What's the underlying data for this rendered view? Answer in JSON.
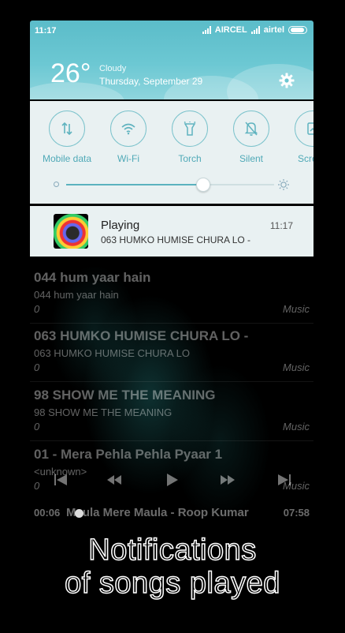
{
  "status_bar": {
    "time": "11:17",
    "carrier1": "AIRCEL",
    "carrier2": "airtel"
  },
  "weather": {
    "temperature": "26°",
    "condition": "Cloudy",
    "date": "Thursday, September 29"
  },
  "quick_settings": {
    "toggles": [
      {
        "label": "Mobile data",
        "icon": "mobile-data-icon"
      },
      {
        "label": "Wi-Fi",
        "icon": "wifi-icon"
      },
      {
        "label": "Torch",
        "icon": "torch-icon"
      },
      {
        "label": "Silent",
        "icon": "silent-bell-icon"
      },
      {
        "label": "Screen",
        "icon": "screenshot-icon"
      }
    ],
    "brightness_level": 0.66
  },
  "notification": {
    "title": "Playing",
    "subtitle": "063 HUMKO HUMISE CHURA LO -",
    "time": "11:17"
  },
  "songs": [
    {
      "title": "044 hum yaar hain",
      "artist": "044 hum yaar hain",
      "number": "0",
      "genre": "Music"
    },
    {
      "title": "063 HUMKO HUMISE CHURA LO -",
      "artist": "063 HUMKO HUMISE CHURA LO",
      "number": "0",
      "genre": "Music"
    },
    {
      "title": "98 SHOW ME THE MEANING",
      "artist": "98 SHOW ME THE MEANING",
      "number": "0",
      "genre": "Music"
    },
    {
      "title": "01 -  Mera Pehla Pehla Pyaar 1",
      "artist": "<unknown>",
      "number": "0",
      "genre": "Music"
    }
  ],
  "player": {
    "elapsed": "00:06",
    "now_playing": "Maula Mere Maula - Roop Kumar",
    "total": "07:58",
    "progress": 0.013
  },
  "caption": {
    "line1": "Notifications",
    "line2": "of songs played"
  }
}
